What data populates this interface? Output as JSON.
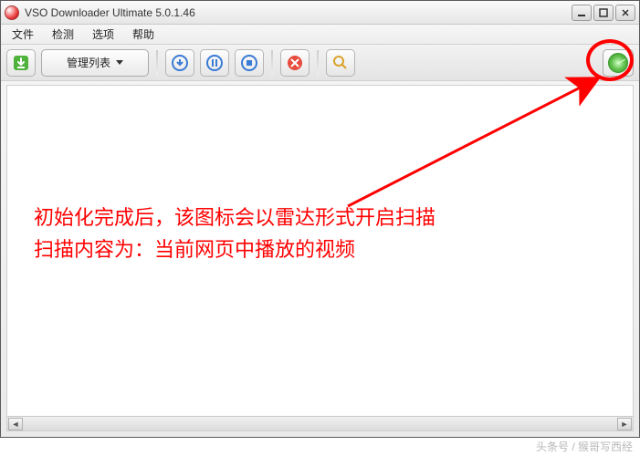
{
  "window": {
    "title": "VSO Downloader Ultimate 5.0.1.46"
  },
  "menu": {
    "file": "文件",
    "detect": "检测",
    "options": "选项",
    "help": "帮助"
  },
  "toolbar": {
    "manage_label": "管理列表"
  },
  "annotation": {
    "line1": "初始化完成后，该图标会以雷达形式开启扫描",
    "line2": "扫描内容为：当前网页中播放的视频"
  },
  "watermark": "头条号 / 猴哥写西经",
  "colors": {
    "annotation": "#ff0000"
  }
}
